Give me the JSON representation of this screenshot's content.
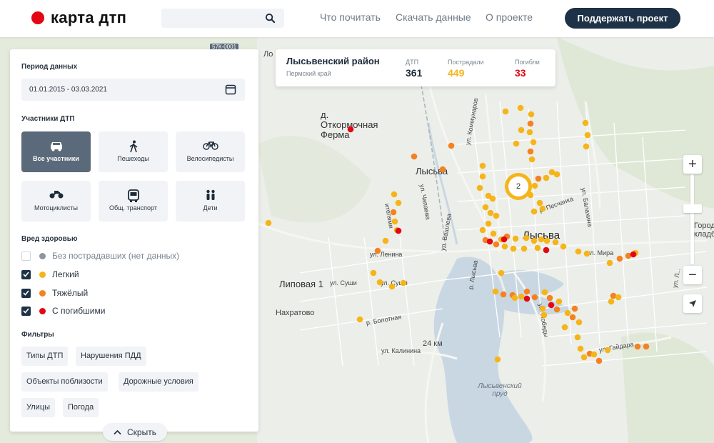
{
  "header": {
    "logo_text": "карта дтп",
    "search_placeholder": "",
    "nav": [
      "Что почитать",
      "Скачать данные",
      "О проекте"
    ],
    "support_button": "Поддержать проект"
  },
  "sidebar": {
    "period_title": "Период данных",
    "period_value": "01.01.2015 - 03.03.2021",
    "participants_title": "Участники ДТП",
    "participants": [
      {
        "label": "Все участники",
        "icon": "car-icon",
        "active": true
      },
      {
        "label": "Пешеходы",
        "icon": "pedestrian-icon",
        "active": false
      },
      {
        "label": "Велосипедисты",
        "icon": "bicycle-icon",
        "active": false
      },
      {
        "label": "Мотоциклисты",
        "icon": "motorcycle-icon",
        "active": false
      },
      {
        "label": "Общ. транспорт",
        "icon": "bus-icon",
        "active": false
      },
      {
        "label": "Дети",
        "icon": "children-icon",
        "active": false
      }
    ],
    "harm_title": "Вред здоровью",
    "harm": [
      {
        "label": "Без пострадавших (нет данных)",
        "checked": false,
        "color": "#8a96a3"
      },
      {
        "label": "Легкий",
        "checked": true,
        "color": "#f5b51a"
      },
      {
        "label": "Тяжёлый",
        "checked": true,
        "color": "#f58220"
      },
      {
        "label": "С погибшими",
        "checked": true,
        "color": "#e30613"
      }
    ],
    "filters_title": "Фильтры",
    "filters": [
      "Типы ДТП",
      "Нарушения ПДД",
      "Объекты поблизости",
      "Дорожные условия",
      "Улицы",
      "Погода"
    ],
    "hide_button": "Скрыть"
  },
  "stats": {
    "region": "Лысьвенский район",
    "subregion": "Пермский край",
    "dtp_label": "ДТП",
    "dtp_value": "361",
    "injured_label": "Пострадали",
    "injured_value": "449",
    "killed_label": "Погибли",
    "killed_value": "33",
    "colors": {
      "injured": "#f5b51a",
      "killed": "#e30613"
    }
  },
  "map": {
    "places": {
      "otkorm": "д. Откормочная Ферма",
      "lysva_station": "Лысьва",
      "lysva_city": "Лысьва",
      "lipovaya": "Липовая 1",
      "nakhratovo": "Нахратово",
      "km24": "24 км",
      "pond": "Лысьвенский пруд",
      "gorod": "Город кладб",
      "road_code": "57К-0001",
      "lo": "Ло"
    },
    "streets": {
      "kommun": "ул. Коммунаров",
      "balakhina": "ул. Балахина",
      "chapaeva": "ул. Чапаева",
      "peschanka": "р. Песчанка",
      "lenina": "ул. Ленина",
      "mira": "ул. Мира",
      "susha1": "ул. Суши",
      "susha2": "ул. Суши",
      "vashleva": "ул. Вашлева",
      "r_lysva": "р. Лысьва",
      "bolotnaya": "р. Болотная",
      "kalinina": "ул. Калинина",
      "gaydara": "ул. Гайдара",
      "pobedy": "ул. Победы",
      "left_v": "ителями",
      "right_v": "ул. Л..."
    },
    "cluster_count": "2",
    "colors": {
      "light": "#f5b51a",
      "heavy": "#f58220",
      "dead": "#e30613"
    }
  }
}
